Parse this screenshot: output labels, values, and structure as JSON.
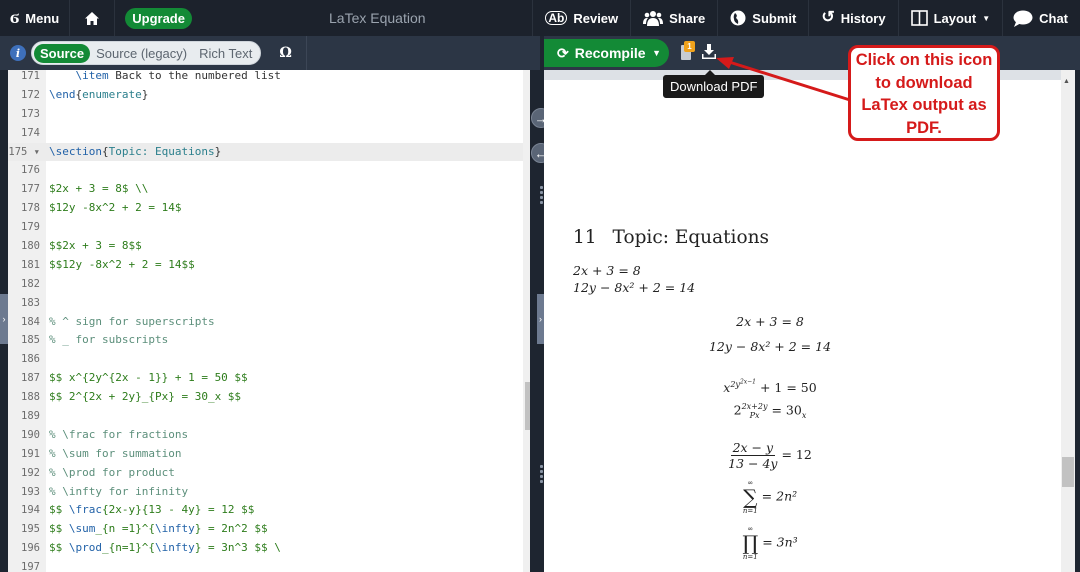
{
  "topbar": {
    "menu_label": "Menu",
    "upgrade_label": "Upgrade",
    "title": "LaTex Equation",
    "review_label": "Review",
    "share_label": "Share",
    "submit_label": "Submit",
    "history_label": "History",
    "layout_label": "Layout",
    "chat_label": "Chat"
  },
  "editor_toolbar": {
    "info_label": "i",
    "modes": [
      "Source",
      "Source (legacy)",
      "Rich Text"
    ],
    "active_mode": "Source",
    "symbol_label": "Ω"
  },
  "editor": {
    "lines": [
      {
        "num": "171",
        "text": "    \\item Back to the numbered list"
      },
      {
        "num": "172",
        "text": "\\end{enumerate}"
      },
      {
        "num": "173",
        "text": ""
      },
      {
        "num": "174",
        "text": ""
      },
      {
        "num": "175 ▾",
        "text": "\\section{Topic: Equations}"
      },
      {
        "num": "176",
        "text": ""
      },
      {
        "num": "177",
        "text": "$2x + 3 = 8$ \\\\"
      },
      {
        "num": "178",
        "text": "$12y -8x^2 + 2 = 14$"
      },
      {
        "num": "179",
        "text": ""
      },
      {
        "num": "180",
        "text": "$$2x + 3 = 8$$"
      },
      {
        "num": "181",
        "text": "$$12y -8x^2 + 2 = 14$$"
      },
      {
        "num": "182",
        "text": ""
      },
      {
        "num": "183",
        "text": ""
      },
      {
        "num": "184",
        "text": "% ^ sign for superscripts"
      },
      {
        "num": "185",
        "text": "% _ for subscripts"
      },
      {
        "num": "186",
        "text": ""
      },
      {
        "num": "187",
        "text": "$$ x^{2y^{2x - 1}} + 1 = 50 $$"
      },
      {
        "num": "188",
        "text": "$$ 2^{2x + 2y}_{Px} = 30_x $$"
      },
      {
        "num": "189",
        "text": ""
      },
      {
        "num": "190",
        "text": "% \\frac for fractions"
      },
      {
        "num": "191",
        "text": "% \\sum for summation"
      },
      {
        "num": "192",
        "text": "% \\prod for product"
      },
      {
        "num": "193",
        "text": "% \\infty for infinity"
      },
      {
        "num": "194",
        "text": "$$ \\frac{2x-y}{13 - 4y} = 12 $$"
      },
      {
        "num": "195",
        "text": "$$ \\sum_{n =1}^{\\infty} = 2n^2 $$"
      },
      {
        "num": "196",
        "text": "$$ \\prod_{n=1}^{\\infty} = 3n^3 $$ \\"
      },
      {
        "num": "197",
        "text": ""
      }
    ]
  },
  "pdf_toolbar": {
    "recompile_label": "Recompile",
    "logs_badge": "1",
    "download_tooltip": "Download PDF"
  },
  "pdf": {
    "section_number": "11",
    "section_title": "Topic: Equations",
    "inline_eq1": "2x + 3 = 8",
    "inline_eq2": "12y − 8x² + 2 = 14",
    "display_eq1": "2x + 3 = 8",
    "display_eq2": "12y − 8x² + 2 = 14",
    "eq_power": "x^{2y^{2x−1}} + 1 = 50",
    "eq_sub": "2^{2x+2y}_{Px} = 30_x",
    "frac_num": "2x − y",
    "frac_den": "13 − 4y",
    "frac_rhs": "= 12",
    "sum_rhs": "= 2n²",
    "prod_rhs": "= 3n³",
    "limit_upper": "∞",
    "limit_lower": "n=1"
  },
  "annotation": {
    "callout_text": "Click on this icon to download LaTex output as PDF.",
    "callout_color": "#d51a1a"
  },
  "colors": {
    "accent_green": "#138a36",
    "topbar_bg": "#1c222c",
    "toolbar_bg": "#2c3645"
  }
}
